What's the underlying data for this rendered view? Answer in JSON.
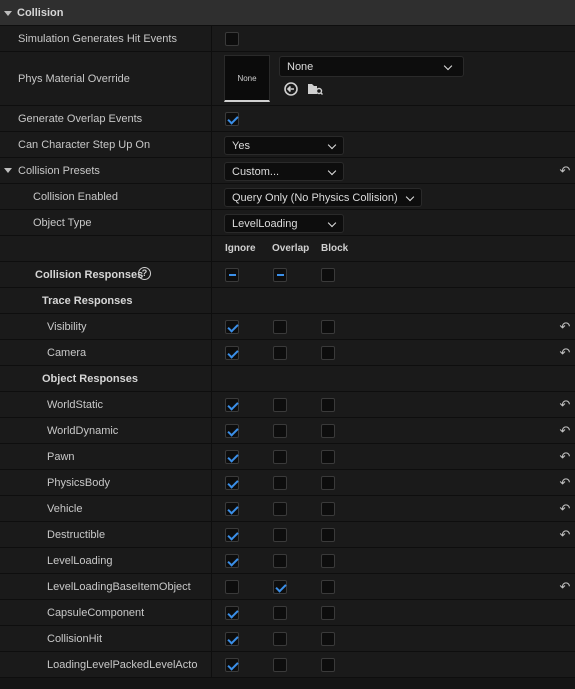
{
  "section": {
    "title": "Collision"
  },
  "sim_hit": {
    "label": "Simulation Generates Hit Events",
    "checked": false
  },
  "phys_material": {
    "label": "Phys Material Override",
    "thumb": "None",
    "value": "None"
  },
  "overlap": {
    "label": "Generate Overlap Events",
    "checked": true
  },
  "step_up": {
    "label": "Can Character Step Up On",
    "value": "Yes"
  },
  "presets": {
    "label": "Collision Presets",
    "value": "Custom..."
  },
  "collision_enabled": {
    "label": "Collision Enabled",
    "value": "Query Only (No Physics Collision)"
  },
  "object_type": {
    "label": "Object Type",
    "value": "LevelLoading"
  },
  "columns": {
    "ignore": "Ignore",
    "overlap": "Overlap",
    "block": "Block"
  },
  "responses": {
    "label": "Collision Responses",
    "help_icon": "?"
  },
  "trace": {
    "label": "Trace Responses"
  },
  "object": {
    "label": "Object Responses"
  },
  "trace_rows": [
    {
      "label": "Visibility",
      "state": "ignore",
      "reset": true
    },
    {
      "label": "Camera",
      "state": "ignore",
      "reset": true
    }
  ],
  "object_rows": [
    {
      "label": "WorldStatic",
      "state": "ignore",
      "reset": true
    },
    {
      "label": "WorldDynamic",
      "state": "ignore",
      "reset": true
    },
    {
      "label": "Pawn",
      "state": "ignore",
      "reset": true
    },
    {
      "label": "PhysicsBody",
      "state": "ignore",
      "reset": true
    },
    {
      "label": "Vehicle",
      "state": "ignore",
      "reset": true
    },
    {
      "label": "Destructible",
      "state": "ignore",
      "reset": true
    },
    {
      "label": "LevelLoading",
      "state": "ignore",
      "reset": false
    },
    {
      "label": "LevelLoadingBaseItemObject",
      "state": "overlap",
      "reset": true
    },
    {
      "label": "CapsuleComponent",
      "state": "ignore",
      "reset": false
    },
    {
      "label": "CollisionHit",
      "state": "ignore",
      "reset": false
    },
    {
      "label": "LoadingLevelPackedLevelActo",
      "state": "ignore",
      "reset": false
    }
  ]
}
